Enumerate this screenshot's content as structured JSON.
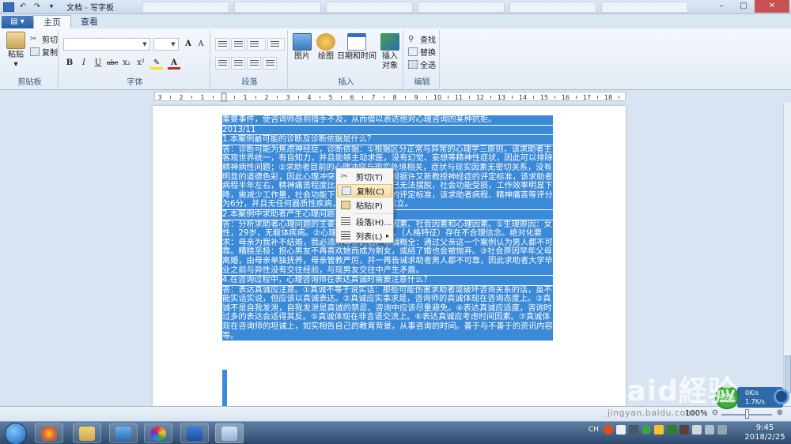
{
  "window": {
    "title": "文档 - 写字板",
    "qat_undo": "↶",
    "qat_redo": "↷",
    "qat_more": "▾",
    "minimize": "–",
    "maximize": "□",
    "close": "✕"
  },
  "ribbon_tabs": {
    "app_menu": "▤ ▾",
    "home": "主页",
    "view": "查看"
  },
  "clipboard": {
    "paste": "粘贴",
    "paste_arrow": "▾",
    "cut": "剪切",
    "copy": "复制",
    "group_label": "剪贴板"
  },
  "font": {
    "family_value": "",
    "size_value": "",
    "grow": "A",
    "shrink": "A",
    "bold": "B",
    "italic": "I",
    "underline": "U",
    "strike": "abc",
    "subscript": "x₂",
    "superscript": "x²",
    "highlight": "✎",
    "color": "A",
    "group_label": "字体"
  },
  "paragraph": {
    "group_label": "段落"
  },
  "insert": {
    "picture": "图片",
    "paint": "绘图",
    "datetime": "日期和时间",
    "object_line1": "插入",
    "object_line2": "对象",
    "group_label": "插入"
  },
  "editing": {
    "find": "查找",
    "replace": "替换",
    "select_all": "全选",
    "group_label": "编辑"
  },
  "ruler_labels": [
    "3",
    "2",
    "1",
    "",
    "1",
    "2",
    "3",
    "4",
    "5",
    "6",
    "7",
    "8",
    "9",
    "10",
    "11",
    "12",
    "13",
    "14",
    "15",
    "16",
    "17",
    "18"
  ],
  "document": {
    "paragraphs": [
      "重要事件，使咨询师感到措手不及，从而借以表达他对心理咨询的某种抗拒。",
      "2013/11",
      "1.本案例最可能的诊断及诊断依据是什么？",
      "答：诊断可能为焦虑神经症，诊断依据：①根据区分正常与异常的心理学三原则，该求助者主客观世界统一，有自知力，并且能够主动求医，没有幻觉、妄想等精神性症状，因此可以排除精神病性问题；②求助者目前的心理冲突与现实处境相关，症状与现实因素无密切关系，没有明显的道德色彩，因此心理冲突属于变形冲突，根据许又新教授神经症的评定标准，该求助者病程半年左右，精神痛苦程度比较严重，依靠自己无法摆脱，社会功能受损，工作效率明显下降，需减少工作量，社会功能下降。根据神经症的评定标准，该求助者病程、精神痛苦等评分为6分，并且无任何器质性疾病，故神经症诊断成立。",
      "2.本案例中求助者产生心理问题的原因有哪些？",
      "答：分析求助者心理问题的主要原因，包括生理因素、社会因素和心理因素。①生理原因：女性，29岁，无躯体疾病。②心理原因：性格内向，（人格特征）存在不合理信念。绝对化要求：母亲为我补不结婚，我必须听母亲的话。以偏概全：通过父亲这一个案例认为男人都不可靠。糟糕至极：担心男友不再喜欢她而成为剩女，或结了婚也会被抛弃。③社会原因早年父母离婚，由母亲单独抚养，母亲管教严厉，并一再告诫求助者男人都不可靠，因此求助者大学毕业之前与异性没有交往经验，与现男友交往中产生矛盾。",
      "4.在咨询过程中，心理咨询师在表达真诚时需要注意什么？",
      "答：表达真诚应注意。①真诚不等于说实话：那些可能伤害求助者或破坏咨询关系的话，虽不能实话实说，但应该以真诚表达。②真诚应实事求是，咨询师的真诚体现在咨询态度上。③真诚不是自我发泄，自我发泄是真诚的禁忌，咨询中应该尽量避免。④表达真诚应适度，咨询时过多的表达会适得其反。⑤真诚体现在非言语交流上。⑥表达真诚应考虑时间因素。⑦真诚体现在咨询师的坦诚上，如实相告自己的教育背景，从事咨询的时间。善于与不善于的资讯内容等。"
    ]
  },
  "context_menu": {
    "cut": "剪切(T)",
    "copy": "复制(C)",
    "paste": "粘贴(P)",
    "paragraph": "段落(H)...",
    "list": "列表(L)",
    "list_arrow": "▸"
  },
  "statusbar": {
    "zoom": "100%",
    "zoom_out": "⊖",
    "zoom_in": "⊕"
  },
  "net_widget": {
    "percent": "45%",
    "down": "0K/s",
    "up": "1.7K/s"
  },
  "watermark": {
    "main": "Baid経验",
    "sub": "jingyan.baidu.com"
  },
  "taskbar": {
    "lang": "CH",
    "time": "9:45",
    "date": "2018/2/25"
  },
  "colors": {
    "selection": "#3b8ad8",
    "ribbon_bg": "#e3ebf5",
    "taskbar": "#2d4a6e"
  }
}
